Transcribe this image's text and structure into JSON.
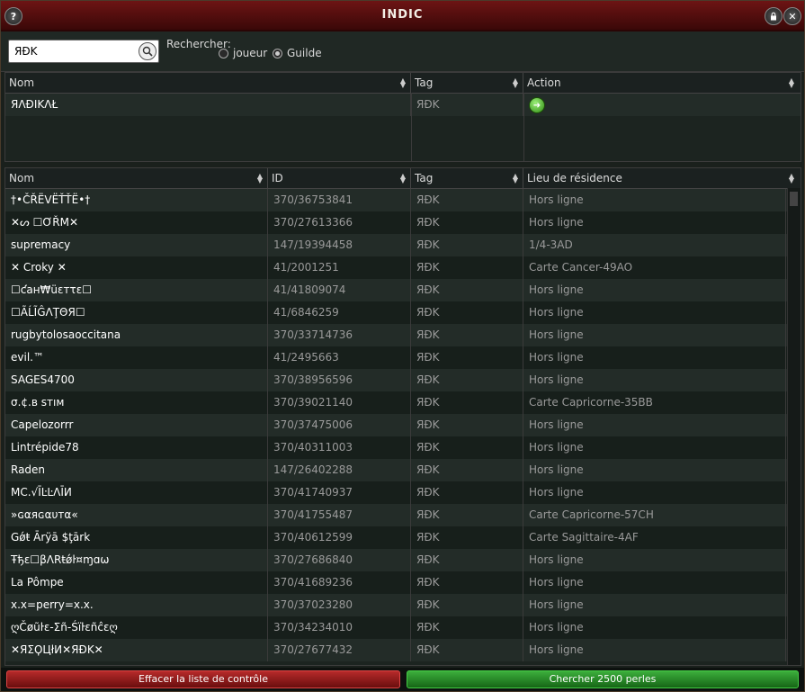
{
  "window": {
    "title": "INDIC"
  },
  "search": {
    "value": "ЯÐK",
    "label": "Rechercher:",
    "radio_player": "joueur",
    "radio_guild": "Guilde",
    "selected": "Guilde"
  },
  "guild_table": {
    "headers": [
      "Nom",
      "Tag",
      "Action"
    ],
    "rows": [
      {
        "nom": "ЯΛÐIKΛŁ",
        "tag": "ЯÐK",
        "action": "join-icon"
      }
    ]
  },
  "member_table": {
    "headers": [
      "Nom",
      "ID",
      "Tag",
      "Lieu de résidence"
    ],
    "rows": [
      {
        "nom": "†•ČŘËVËŤŤË•†",
        "id": "370/36753841",
        "tag": "ЯÐK",
        "lieu": "Hors ligne"
      },
      {
        "nom": "✕ᔕ ☐ƠŘΜ✕",
        "id": "370/27613366",
        "tag": "ЯÐK",
        "lieu": "Hors ligne"
      },
      {
        "nom": "supremacy",
        "id": "147/19394458",
        "tag": "ЯÐK",
        "lieu": "1/4-3AD"
      },
      {
        "nom": "✕ Croky ✕",
        "id": "41/2001251",
        "tag": "ЯÐK",
        "lieu": "Carte Cancer-49AO"
      },
      {
        "nom": "☐ƈaн₩üεтτε☐",
        "id": "41/41809074",
        "tag": "ЯÐK",
        "lieu": "Hors ligne"
      },
      {
        "nom": "☐ÃĹĨĜΛŢΘЯ☐",
        "id": "41/6846259",
        "tag": "ЯÐK",
        "lieu": "Hors ligne"
      },
      {
        "nom": "rugbytolosaoccitana",
        "id": "370/33714736",
        "tag": "ЯÐK",
        "lieu": "Hors ligne"
      },
      {
        "nom": "evil.™",
        "id": "41/2495663",
        "tag": "ЯÐK",
        "lieu": "Hors ligne"
      },
      {
        "nom": "SAGES4700",
        "id": "370/38956596",
        "tag": "ЯÐK",
        "lieu": "Hors ligne"
      },
      {
        "nom": "σ.¢.в sтıм",
        "id": "370/39021140",
        "tag": "ЯÐK",
        "lieu": "Carte Capricorne-35BB"
      },
      {
        "nom": "Capelozorrr",
        "id": "370/37475006",
        "tag": "ЯÐK",
        "lieu": "Hors ligne"
      },
      {
        "nom": "Lintrépide78",
        "id": "370/40311003",
        "tag": "ЯÐK",
        "lieu": "Hors ligne"
      },
      {
        "nom": "Raden",
        "id": "147/26402288",
        "tag": "ЯÐK",
        "lieu": "Hors ligne"
      },
      {
        "nom": "MC.√ĪĿĿΛĪИ",
        "id": "370/41740937",
        "tag": "ЯÐK",
        "lieu": "Hors ligne"
      },
      {
        "nom": "»ɢαяɢαυтα«",
        "id": "370/41755487",
        "tag": "ЯÐK",
        "lieu": "Carte Capricorne-57CH"
      },
      {
        "nom": "Gǿŧ Ārÿā $ţārk",
        "id": "370/40612599",
        "tag": "ЯÐK",
        "lieu": "Carte Sagittaire-4AF"
      },
      {
        "nom": "Ŧђɛ☐βΛRŧǿŀ¤ɱɑω",
        "id": "370/27686840",
        "tag": "ЯÐK",
        "lieu": "Hors ligne"
      },
      {
        "nom": "La Pômpe",
        "id": "370/41689236",
        "tag": "ЯÐK",
        "lieu": "Hors ligne"
      },
      {
        "nom": "x.x=perry=x.x.",
        "id": "370/37023280",
        "tag": "ЯÐK",
        "lieu": "Hors ligne"
      },
      {
        "nom": "ღČøũŀɛ-Σñ-Śïŀɛñĉɛღ",
        "id": "370/34234010",
        "tag": "ЯÐK",
        "lieu": "Hors ligne"
      },
      {
        "nom": "✕ЯΣϘЦłИ✕ЯÐK✕",
        "id": "370/27677432",
        "tag": "ЯÐK",
        "lieu": "Hors ligne"
      }
    ]
  },
  "buttons": {
    "clear": "Effacer la liste de contrôle",
    "search": "Chercher 2500 perles"
  },
  "colors": {
    "accent_red": "#6d1414",
    "accent_green": "#2e8a12"
  }
}
